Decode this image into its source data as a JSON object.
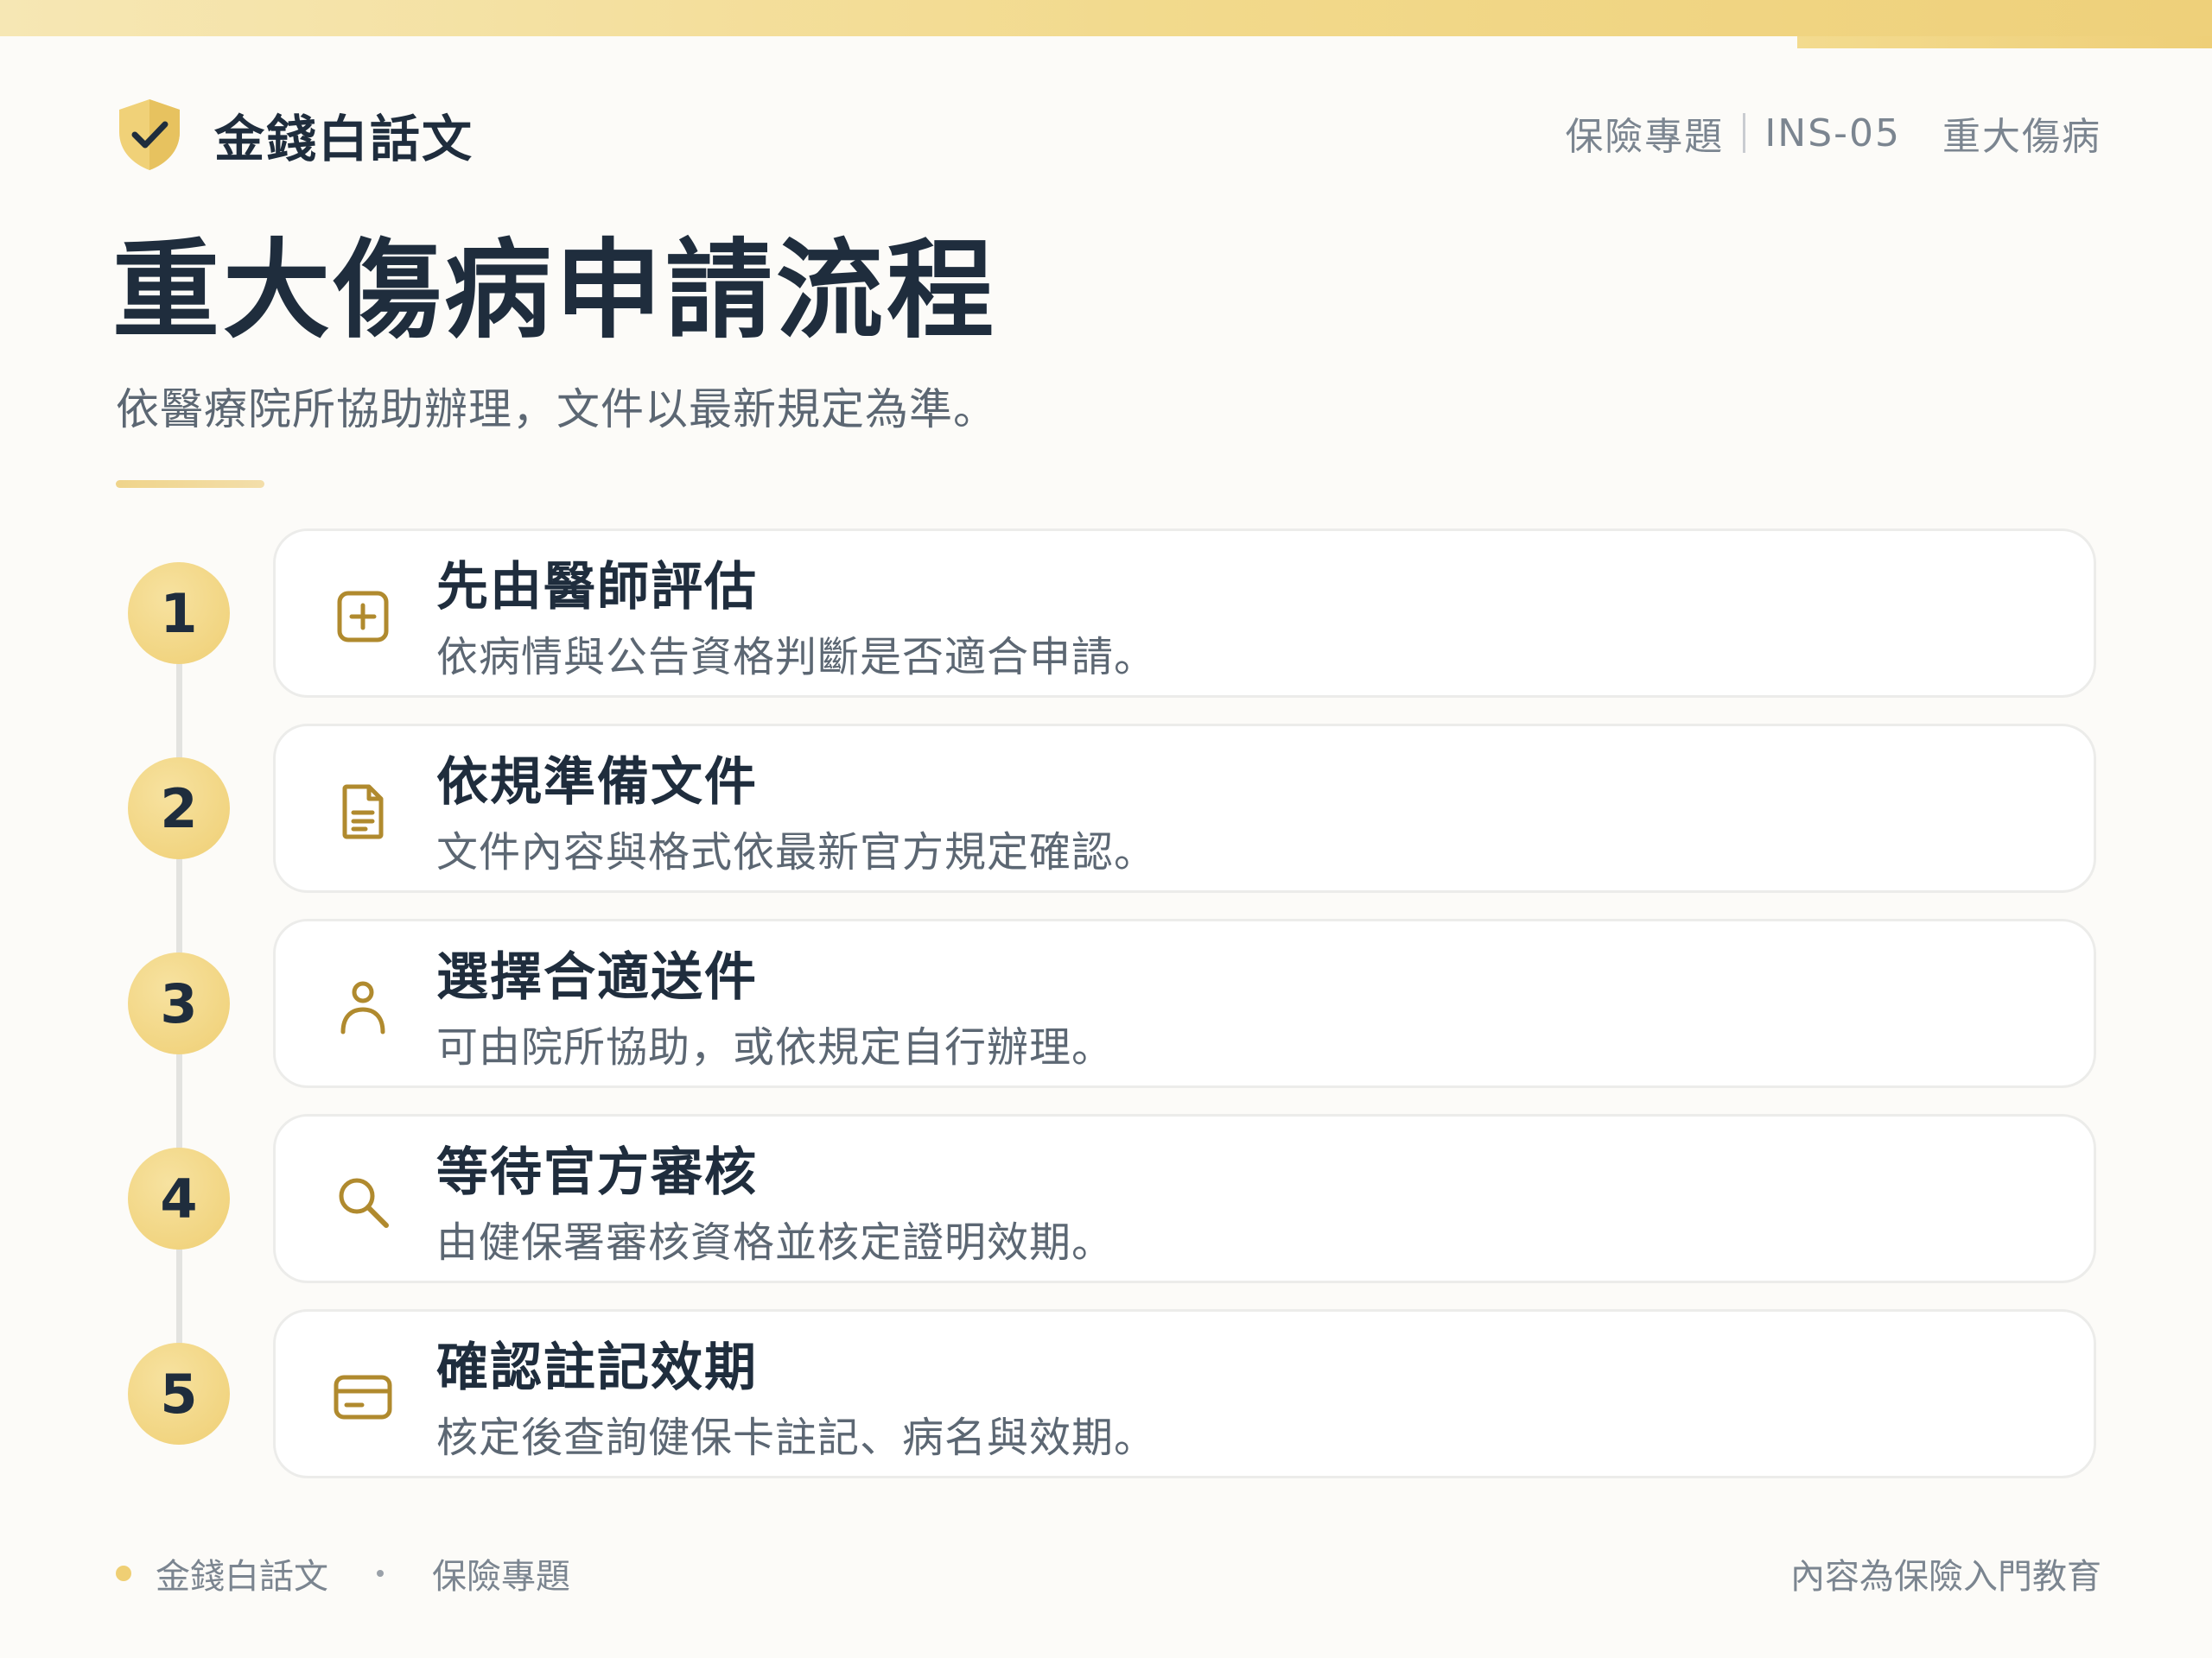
{
  "brand": {
    "name": "金錢白話文",
    "icon": "shield-check-icon"
  },
  "header": {
    "category": "保險專題",
    "code": "INS-05",
    "topic": "重大傷病"
  },
  "title": "重大傷病申請流程",
  "subtitle": "依醫療院所協助辦理，文件以最新規定為準。",
  "steps": [
    {
      "number": "1",
      "title": "先由醫師評估",
      "desc": "依病情與公告資格判斷是否適合申請。",
      "icon": "medical-plus-icon"
    },
    {
      "number": "2",
      "title": "依規準備文件",
      "desc": "文件內容與格式依最新官方規定確認。",
      "icon": "document-icon"
    },
    {
      "number": "3",
      "title": "選擇合適送件",
      "desc": "可由院所協助，或依規定自行辦理。",
      "icon": "person-icon"
    },
    {
      "number": "4",
      "title": "等待官方審核",
      "desc": "由健保署審核資格並核定證明效期。",
      "icon": "search-icon"
    },
    {
      "number": "5",
      "title": "確認註記效期",
      "desc": "核定後查詢健保卡註記、病名與效期。",
      "icon": "card-icon"
    }
  ],
  "footer": {
    "brand": "金錢白話文",
    "category": "保險專題",
    "note": "內容為保險入門教育"
  },
  "colors": {
    "accent": "#efcf74",
    "icon": "#b08a2e",
    "text": "#1f2d3d",
    "muted": "#5c6773"
  }
}
